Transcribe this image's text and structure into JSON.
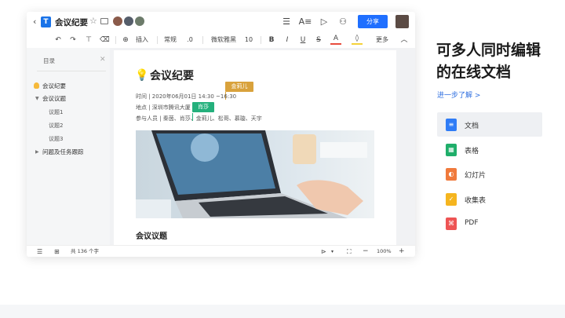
{
  "doc": {
    "title": "会议纪要",
    "share_label": "分享"
  },
  "toolbar": {
    "insert_label": "插入",
    "style_label": "常规",
    "spacing_label": ".0",
    "font_label": "微软雅黑",
    "size_label": "10",
    "more_label": "更多"
  },
  "toc": {
    "header": "目录",
    "items": [
      {
        "label": "会议纪要"
      },
      {
        "label": "会议议题"
      },
      {
        "label": "议题1"
      },
      {
        "label": "议题2"
      },
      {
        "label": "议题3"
      },
      {
        "label": "问题及任务跟踪"
      }
    ]
  },
  "content": {
    "heading": "会议纪要",
    "time_line": "时间 | 2020年06月01日  14:30 ~16:30",
    "place_line": "地点 | 深圳市腾讯大厦",
    "attendees_line": "参与人员 | 秦茵、肖莎、金莉儿、松哥、慕璇、天宇",
    "collab_tag_1": "金莉儿",
    "collab_tag_2": "肖莎",
    "section_heading": "会议议题"
  },
  "status": {
    "word_count": "共 136 个字",
    "zoom": "100%"
  },
  "promo": {
    "title": "可多人同时编辑的在线文档",
    "link": "进一步了解 >",
    "features": [
      {
        "label": "文档",
        "icon": "doc-icon",
        "color": "#2f7cf6"
      },
      {
        "label": "表格",
        "icon": "sheet-icon",
        "color": "#1fae6a"
      },
      {
        "label": "幻灯片",
        "icon": "slides-icon",
        "color": "#f07a3c"
      },
      {
        "label": "收集表",
        "icon": "form-icon",
        "color": "#f5b51f"
      },
      {
        "label": "PDF",
        "icon": "pdf-icon",
        "color": "#ee5454"
      }
    ]
  }
}
